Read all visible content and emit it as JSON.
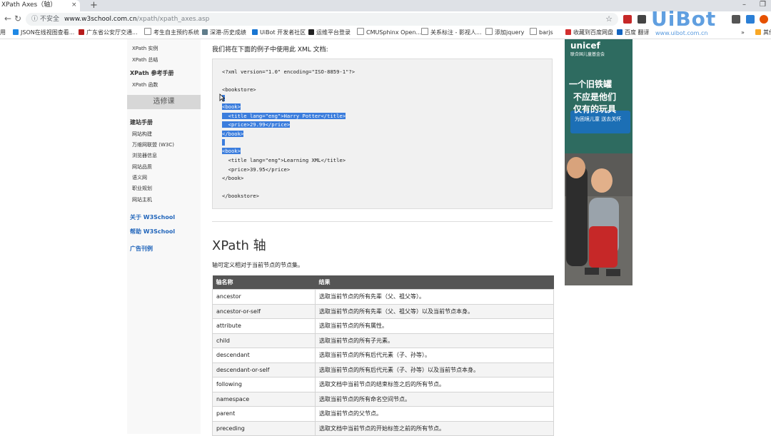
{
  "browser": {
    "tab_title": "XPath Axes（轴）",
    "tab_close": "×",
    "new_tab": "+",
    "insecure_label": "不安全",
    "url_host": "www.w3school.com.cn",
    "url_path": "/xpath/xpath_axes.asp",
    "bookmarks": [
      "用",
      "JSON在线视图查看...",
      "广东省公安厅交通...",
      "考生自主预约系统",
      "深港-历史成绩",
      "UiBot 开发者社区",
      "运维平台登录",
      "CMUSphinx Open...",
      "关系标注 - 影视人...",
      "添加jquery",
      "barjs",
      "收藏到百度网盘",
      "百度 翻译",
      "其他",
      "其他"
    ]
  },
  "watermark": {
    "brand": "UiBot",
    "url": "www.uibot.com.cn"
  },
  "sidebar": {
    "top_items": [
      "XPath 实例",
      "XPath 总结"
    ],
    "reference_heading": "XPath 参考手册",
    "reference_items": [
      "XPath 函数"
    ],
    "select_course": "选修课",
    "build_heading": "建站手册",
    "build_items": [
      "网站构建",
      "万维网联盟 (W3C)",
      "浏览器信息",
      "网站品质",
      "语义网",
      "职业规划",
      "网站主机"
    ],
    "about": "关于 W3School",
    "help": "帮助 W3School",
    "ads": "广告刊例"
  },
  "main": {
    "intro": "我们将在下面的例子中使用此 XML 文档:",
    "code_lines": [
      "<?xml version=\"1.0\" encoding=\"ISO-8859-1\"?>",
      "",
      "<bookstore>",
      "",
      "<book>",
      "  <title lang=\"eng\">Harry Potter</title>",
      "  <price>29.99</price>",
      "</book>",
      "",
      "<book>",
      "  <title lang=\"eng\">Learning XML</title>",
      "  <price>39.95</price>",
      "</book>",
      "",
      "</bookstore>"
    ],
    "heading": "XPath 轴",
    "para": "轴可定义相对于当前节点的节点集。",
    "table": {
      "headers": [
        "轴名称",
        "结果"
      ],
      "rows": [
        [
          "ancestor",
          "选取当前节点的所有先辈（父、祖父等）。"
        ],
        [
          "ancestor-or-self",
          "选取当前节点的所有先辈（父、祖父等）以及当前节点本身。"
        ],
        [
          "attribute",
          "选取当前节点的所有属性。"
        ],
        [
          "child",
          "选取当前节点的所有子元素。"
        ],
        [
          "descendant",
          "选取当前节点的所有后代元素（子、孙等）。"
        ],
        [
          "descendant-or-self",
          "选取当前节点的所有后代元素（子、孙等）以及当前节点本身。"
        ],
        [
          "following",
          "选取文档中当前节点的结束标签之后的所有节点。"
        ],
        [
          "namespace",
          "选取当前节点的所有命名空间节点。"
        ],
        [
          "parent",
          "选取当前节点的父节点。"
        ],
        [
          "preceding",
          "选取文档中当前节点的开始标签之前的所有节点。"
        ]
      ]
    }
  },
  "ad": {
    "brand": "unicef",
    "org": "联合国儿童基金会",
    "line1": "一个旧铁罐",
    "line2": "不应是他们",
    "line3": "仅有的玩具",
    "cta": "为困境儿童 送去关怀"
  },
  "colors": {
    "highlight": "#3b7ddd",
    "link": "#2266bb",
    "table_header": "#555555"
  }
}
